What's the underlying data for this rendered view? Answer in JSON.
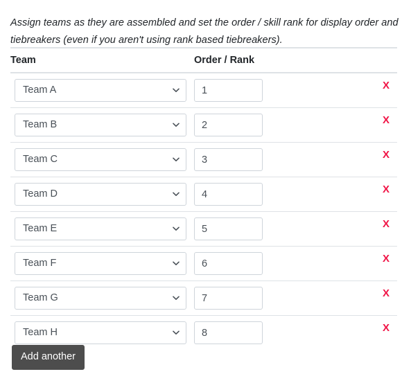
{
  "intro": {
    "text": "Assign teams as they are assembled and set the order / skill rank for display order and tiebreakers (even if you aren't using rank based tiebreakers)."
  },
  "table": {
    "headers": {
      "team": "Team",
      "rank": "Order / Rank"
    },
    "rows": [
      {
        "team": "Team A",
        "rank": "1",
        "delete_label": "X"
      },
      {
        "team": "Team B",
        "rank": "2",
        "delete_label": "X"
      },
      {
        "team": "Team C",
        "rank": "3",
        "delete_label": "X"
      },
      {
        "team": "Team D",
        "rank": "4",
        "delete_label": "X"
      },
      {
        "team": "Team E",
        "rank": "5",
        "delete_label": "X"
      },
      {
        "team": "Team F",
        "rank": "6",
        "delete_label": "X"
      },
      {
        "team": "Team G",
        "rank": "7",
        "delete_label": "X"
      },
      {
        "team": "Team H",
        "rank": "8",
        "delete_label": "X"
      }
    ]
  },
  "actions": {
    "add_another_label": "Add another"
  },
  "colors": {
    "delete_x": "#f01446",
    "button_bg": "#4d4d4d",
    "border": "#dee2e6",
    "input_border": "#ced4da",
    "text": "#212529",
    "input_text": "#495057"
  }
}
